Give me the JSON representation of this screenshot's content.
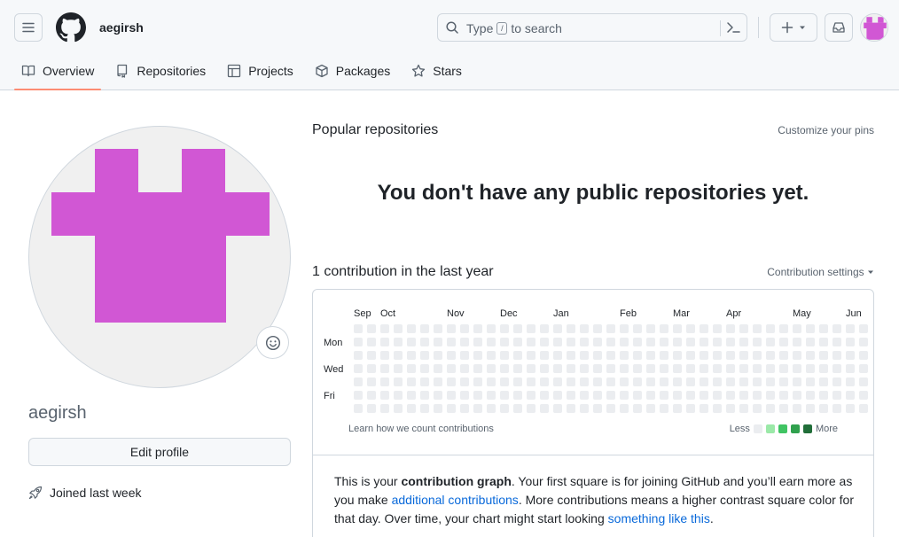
{
  "header": {
    "username": "aegirsh",
    "search_placeholder_pre": "Type",
    "search_key": "/",
    "search_placeholder_post": "to search"
  },
  "tabs": [
    {
      "label": "Overview",
      "icon": "book-icon",
      "selected": true
    },
    {
      "label": "Repositories",
      "icon": "repo-icon",
      "selected": false
    },
    {
      "label": "Projects",
      "icon": "table-icon",
      "selected": false
    },
    {
      "label": "Packages",
      "icon": "package-icon",
      "selected": false
    },
    {
      "label": "Stars",
      "icon": "star-icon",
      "selected": false
    }
  ],
  "profile": {
    "login": "aegirsh",
    "edit_label": "Edit profile",
    "joined": "Joined last week",
    "avatar_color": "#d157d4"
  },
  "popular": {
    "title": "Popular repositories",
    "customize": "Customize your pins",
    "empty": "You don't have any public repositories yet."
  },
  "contributions": {
    "title": "1 contribution in the last year",
    "settings": "Contribution settings",
    "months": [
      "Sep",
      "Oct",
      "Nov",
      "Dec",
      "Jan",
      "Feb",
      "Mar",
      "Apr",
      "May",
      "Jun"
    ],
    "weekdays": [
      "Mon",
      "Wed",
      "Fri"
    ],
    "learn_link": "Learn how we count contributions",
    "legend_less": "Less",
    "legend_more": "More",
    "legend_colors": [
      "#ebedf0",
      "#9be9a8",
      "#40c463",
      "#30a14e",
      "#216e39"
    ],
    "empty_color": "#ebedf0",
    "explain_1": "This is your ",
    "explain_bold": "contribution graph",
    "explain_2": ". Your first square is for joining GitHub and you’ll earn more as you make ",
    "explain_link1": "additional contributions",
    "explain_3": ". More contributions means a higher contrast square color for that day. Over time, your chart might start looking ",
    "explain_link2": "something like this",
    "explain_4": "."
  }
}
